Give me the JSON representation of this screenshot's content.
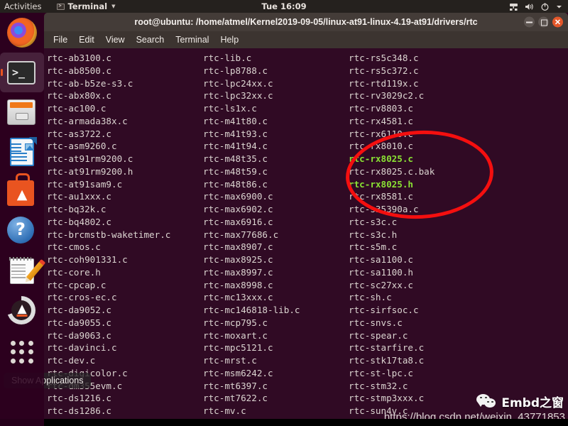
{
  "topbar": {
    "activities": "Activities",
    "app_name": "Terminal",
    "clock": "Tue 16:09",
    "icons": [
      "network-icon",
      "volume-icon",
      "power-icon",
      "chevron-down-icon"
    ]
  },
  "dock": {
    "items": [
      {
        "name": "firefox",
        "label": "Firefox Web Browser",
        "active": false
      },
      {
        "name": "terminal",
        "label": "Terminal",
        "active": true
      },
      {
        "name": "files",
        "label": "Files",
        "active": false
      },
      {
        "name": "writer",
        "label": "LibreOffice Writer",
        "active": false
      },
      {
        "name": "software",
        "label": "Ubuntu Software",
        "active": false
      },
      {
        "name": "help",
        "label": "Help",
        "active": false
      },
      {
        "name": "text-editor",
        "label": "Text Editor",
        "active": false
      },
      {
        "name": "software-updater",
        "label": "Software Updater",
        "active": false
      },
      {
        "name": "show-applications",
        "label": "Show Applications",
        "active": false
      }
    ],
    "tooltip": "Show Applications"
  },
  "terminal": {
    "title": "root@ubuntu: /home/atmel/Kernel2019-09-05/linux-at91-linux-4.19-at91/drivers/rtc",
    "menu": [
      "File",
      "Edit",
      "View",
      "Search",
      "Terminal",
      "Help"
    ],
    "window_buttons": [
      "minimize",
      "maximize",
      "close"
    ],
    "colors": {
      "background": "#300a24",
      "foreground": "#dcd5d1",
      "executable_green": "#8ae234",
      "titlebar": "#443c38",
      "annotation_red": "#f40f0f"
    },
    "columns": [
      {
        "items": [
          {
            "text": "rtc-ab3100.c",
            "type": "file"
          },
          {
            "text": "rtc-ab8500.c",
            "type": "file"
          },
          {
            "text": "rtc-ab-b5ze-s3.c",
            "type": "file"
          },
          {
            "text": "rtc-abx80x.c",
            "type": "file"
          },
          {
            "text": "rtc-ac100.c",
            "type": "file"
          },
          {
            "text": "rtc-armada38x.c",
            "type": "file"
          },
          {
            "text": "rtc-as3722.c",
            "type": "file"
          },
          {
            "text": "rtc-asm9260.c",
            "type": "file"
          },
          {
            "text": "rtc-at91rm9200.c",
            "type": "file"
          },
          {
            "text": "rtc-at91rm9200.h",
            "type": "file"
          },
          {
            "text": "rtc-at91sam9.c",
            "type": "file"
          },
          {
            "text": "rtc-au1xxx.c",
            "type": "file"
          },
          {
            "text": "rtc-bq32k.c",
            "type": "file"
          },
          {
            "text": "rtc-bq4802.c",
            "type": "file"
          },
          {
            "text": "rtc-brcmstb-waketimer.c",
            "type": "file"
          },
          {
            "text": "rtc-cmos.c",
            "type": "file"
          },
          {
            "text": "rtc-coh901331.c",
            "type": "file"
          },
          {
            "text": "rtc-core.h",
            "type": "file"
          },
          {
            "text": "rtc-cpcap.c",
            "type": "file"
          },
          {
            "text": "rtc-cros-ec.c",
            "type": "file"
          },
          {
            "text": "rtc-da9052.c",
            "type": "file"
          },
          {
            "text": "rtc-da9055.c",
            "type": "file"
          },
          {
            "text": "rtc-da9063.c",
            "type": "file"
          },
          {
            "text": "rtc-davinci.c",
            "type": "file"
          },
          {
            "text": "rtc-dev.c",
            "type": "file"
          },
          {
            "text": "rtc-digicolor.c",
            "type": "file"
          },
          {
            "text": "rtc-dm355evm.c",
            "type": "file"
          },
          {
            "text": "rtc-ds1216.c",
            "type": "file"
          },
          {
            "text": "rtc-ds1286.c",
            "type": "file"
          }
        ]
      },
      {
        "items": [
          {
            "text": "rtc-lib.c",
            "type": "file"
          },
          {
            "text": "rtc-lp8788.c",
            "type": "file"
          },
          {
            "text": "rtc-lpc24xx.c",
            "type": "file"
          },
          {
            "text": "rtc-lpc32xx.c",
            "type": "file"
          },
          {
            "text": "rtc-ls1x.c",
            "type": "file"
          },
          {
            "text": "rtc-m41t80.c",
            "type": "file"
          },
          {
            "text": "rtc-m41t93.c",
            "type": "file"
          },
          {
            "text": "rtc-m41t94.c",
            "type": "file"
          },
          {
            "text": "rtc-m48t35.c",
            "type": "file"
          },
          {
            "text": "rtc-m48t59.c",
            "type": "file"
          },
          {
            "text": "rtc-m48t86.c",
            "type": "file"
          },
          {
            "text": "rtc-max6900.c",
            "type": "file"
          },
          {
            "text": "rtc-max6902.c",
            "type": "file"
          },
          {
            "text": "rtc-max6916.c",
            "type": "file"
          },
          {
            "text": "rtc-max77686.c",
            "type": "file"
          },
          {
            "text": "rtc-max8907.c",
            "type": "file"
          },
          {
            "text": "rtc-max8925.c",
            "type": "file"
          },
          {
            "text": "rtc-max8997.c",
            "type": "file"
          },
          {
            "text": "rtc-max8998.c",
            "type": "file"
          },
          {
            "text": "rtc-mc13xxx.c",
            "type": "file"
          },
          {
            "text": "rtc-mc146818-lib.c",
            "type": "file"
          },
          {
            "text": "rtc-mcp795.c",
            "type": "file"
          },
          {
            "text": "rtc-moxart.c",
            "type": "file"
          },
          {
            "text": "rtc-mpc5121.c",
            "type": "file"
          },
          {
            "text": "rtc-mrst.c",
            "type": "file"
          },
          {
            "text": "rtc-msm6242.c",
            "type": "file"
          },
          {
            "text": "rtc-mt6397.c",
            "type": "file"
          },
          {
            "text": "rtc-mt7622.c",
            "type": "file"
          },
          {
            "text": "rtc-mv.c",
            "type": "file"
          }
        ]
      },
      {
        "items": [
          {
            "text": "rtc-rs5c348.c",
            "type": "file"
          },
          {
            "text": "rtc-rs5c372.c",
            "type": "file"
          },
          {
            "text": "rtc-rtd119x.c",
            "type": "file"
          },
          {
            "text": "rtc-rv3029c2.c",
            "type": "file"
          },
          {
            "text": "rtc-rv8803.c",
            "type": "file"
          },
          {
            "text": "rtc-rx4581.c",
            "type": "file"
          },
          {
            "text": "rtc-rx6110.c",
            "type": "file"
          },
          {
            "text": "rtc-rx8010.c",
            "type": "file"
          },
          {
            "text": "rtc-rx8025.c",
            "type": "executable"
          },
          {
            "text": "rtc-rx8025.c.bak",
            "type": "file"
          },
          {
            "text": "rtc-rx8025.h",
            "type": "executable"
          },
          {
            "text": "rtc-rx8581.c",
            "type": "file"
          },
          {
            "text": "rtc-s35390a.c",
            "type": "file"
          },
          {
            "text": "rtc-s3c.c",
            "type": "file"
          },
          {
            "text": "rtc-s3c.h",
            "type": "file"
          },
          {
            "text": "rtc-s5m.c",
            "type": "file"
          },
          {
            "text": "rtc-sa1100.c",
            "type": "file"
          },
          {
            "text": "rtc-sa1100.h",
            "type": "file"
          },
          {
            "text": "rtc-sc27xx.c",
            "type": "file"
          },
          {
            "text": "rtc-sh.c",
            "type": "file"
          },
          {
            "text": "rtc-sirfsoc.c",
            "type": "file"
          },
          {
            "text": "rtc-snvs.c",
            "type": "file"
          },
          {
            "text": "rtc-spear.c",
            "type": "file"
          },
          {
            "text": "rtc-starfire.c",
            "type": "file"
          },
          {
            "text": "rtc-stk17ta8.c",
            "type": "file"
          },
          {
            "text": "rtc-st-lpc.c",
            "type": "file"
          },
          {
            "text": "rtc-stm32.c",
            "type": "file"
          },
          {
            "text": "rtc-stmp3xxx.c",
            "type": "file"
          },
          {
            "text": "rtc-sun4v.c",
            "type": "file"
          }
        ]
      }
    ]
  },
  "watermark": {
    "text": "Embd之窗",
    "url": "https://blog.csdn.net/weixin_43771853"
  }
}
